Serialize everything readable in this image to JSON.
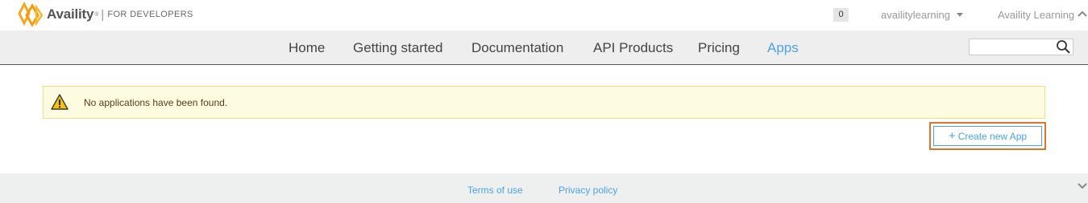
{
  "header": {
    "brand_name": "Availity",
    "brand_tm": "®",
    "brand_separator": "|",
    "brand_tagline": "FOR DEVELOPERS",
    "notification_count": "0",
    "username": "availitylearning",
    "organization": "Availity Learning"
  },
  "nav": {
    "items": [
      {
        "label": "Home"
      },
      {
        "label": "Getting started"
      },
      {
        "label": "Documentation"
      },
      {
        "label": "API Products"
      },
      {
        "label": "Pricing"
      },
      {
        "label": "Apps"
      }
    ],
    "active": "Apps",
    "search": {
      "value": "",
      "placeholder": ""
    }
  },
  "main": {
    "alert_text": "No applications have been found.",
    "create_button_plus": "+",
    "create_button_label": "Create new App"
  },
  "footer": {
    "links": [
      {
        "label": "Terms of use"
      },
      {
        "label": "Privacy policy"
      }
    ]
  },
  "colors": {
    "accent": "#4da3e0",
    "highlight_border": "#e0742a",
    "alert_background": "#fdfce0",
    "nav_background": "#eeeeee"
  }
}
